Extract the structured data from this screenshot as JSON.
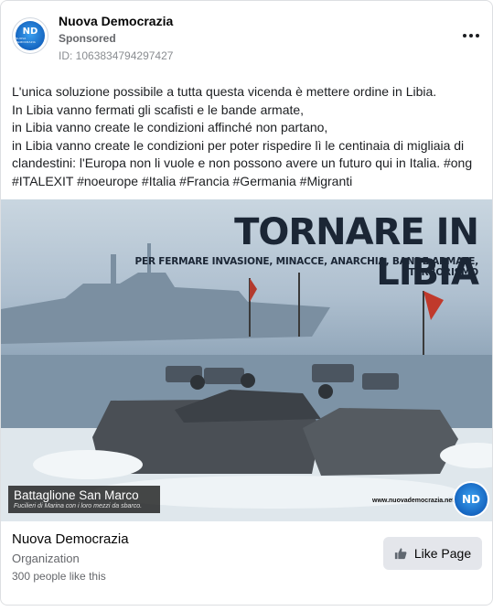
{
  "header": {
    "page_name": "Nuova Democrazia",
    "sponsored": "Sponsored",
    "ad_id": "ID: 1063834794297427",
    "avatar_text": "ND",
    "avatar_sub": "NUOVA DEMOCRAZIA"
  },
  "post": {
    "lines": [
      "L'unica soluzione possibile a tutta questa vicenda è mettere ordine in Libia.",
      "In Libia vanno fermati gli scafisti e le bande armate,",
      "in Libia vanno create le condizioni affinché non partano,",
      "in Libia vanno create le condizioni per poter rispedire lì le centinaia di migliaia di",
      "clandestini: l'Europa non li vuole e non possono avere un futuro qui in Italia. #ong",
      "#ITALEXIT #noeurope #Italia #Francia #Germania #Migranti"
    ]
  },
  "image": {
    "headline": "TORNARE IN LIBIA",
    "subline": "PER FERMARE INVASIONE, MINACCE, ANARCHIA, BANDE ARMATE, TERRORISMO",
    "caption_title": "Battaglione San Marco",
    "caption_sub": "Fucilieri di Marina con i loro mezzi da sbarco.",
    "website": "www.nuovademocrazia.net",
    "badge_text": "ND"
  },
  "footer": {
    "name": "Nuova Democrazia",
    "category": "Organization",
    "likes": "300 people like this",
    "like_button": "Like Page"
  },
  "icons": [
    "more-icon",
    "thumbs-up-icon"
  ]
}
